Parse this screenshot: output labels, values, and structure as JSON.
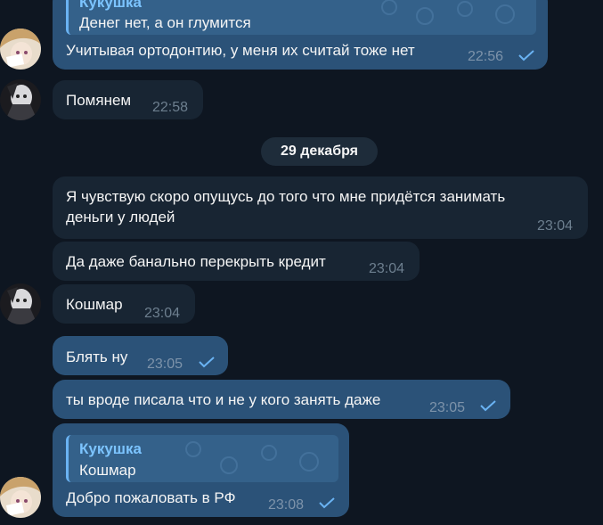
{
  "date_separator": "29 декабря",
  "messages": [
    {
      "reply_author": "Кукушка",
      "reply_text": "Денег нет, а он глумится",
      "text": "Учитывая ортодонтию, у меня их считай тоже нет",
      "time": "22:56"
    },
    {
      "text": "Помянем",
      "time": "22:58"
    },
    {
      "text_line1": "Я чувствую скоро опущусь до того что мне придётся занимать",
      "text_line2": "деньги у людей",
      "time": "23:04"
    },
    {
      "text": "Да даже банально перекрыть кредит",
      "time": "23:04"
    },
    {
      "text": "Кошмар",
      "time": "23:04"
    },
    {
      "text": "Блять ну",
      "time": "23:05"
    },
    {
      "text": "ты вроде писала что и не у кого занять даже",
      "time": "23:05"
    },
    {
      "reply_author": "Кукушка",
      "reply_text": "Кошмар",
      "text": "Добро пожаловать в РФ",
      "time": "23:08"
    }
  ],
  "colors": {
    "background": "#0e1621",
    "outgoing_bubble": "#2b5278",
    "incoming_bubble": "#182533",
    "reply_accent": "#6ab3f3",
    "time_text": "#7d93aa"
  },
  "icons": [
    "read-check-icon",
    "avatar-anime-girl",
    "avatar-dark-figure"
  ]
}
